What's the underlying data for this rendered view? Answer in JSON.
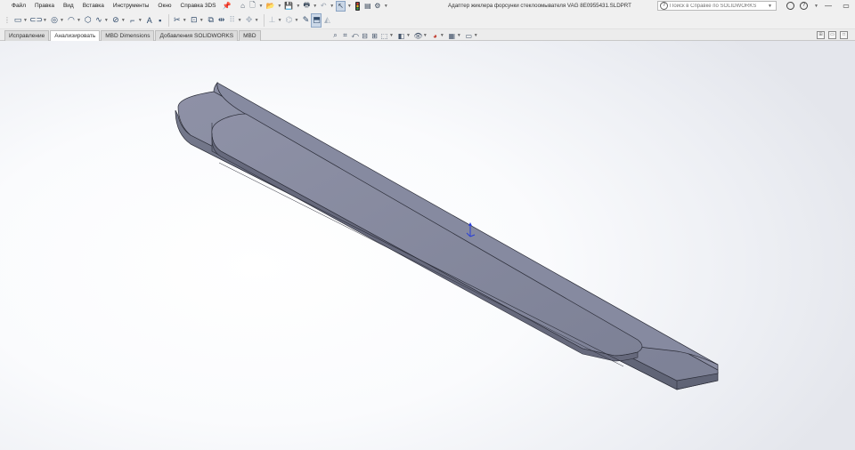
{
  "menu": [
    "Файл",
    "Правка",
    "Вид",
    "Вставка",
    "Инструменты",
    "Окно",
    "Справка 3DS"
  ],
  "document_title": "Адаптер жиклера форсунки стеклоомывателя VAG 8E0955431.SLDPRT",
  "search": {
    "placeholder": "Поиск в Справке по SOLIDWORKS"
  },
  "tabs": [
    "Исправление",
    "Анализировать",
    "MBD Dimensions",
    "Добавления SOLIDWORKS",
    "MBD"
  ],
  "active_tab": "Анализировать",
  "icons": {
    "pin": "📌",
    "home": "⌂",
    "new": "🗋",
    "open": "📂",
    "save": "💾",
    "print": "🖶",
    "undo": "↶",
    "select": "↖",
    "rebuild": "🚦",
    "file_props": "▤",
    "options": "⚙",
    "restore": "▭",
    "close": "✕",
    "minimize": "—"
  },
  "colors": {
    "part_face": "#7f8498",
    "part_top": "#8b8ea3",
    "part_side": "#6c7083",
    "edge": "#2b2d38"
  }
}
